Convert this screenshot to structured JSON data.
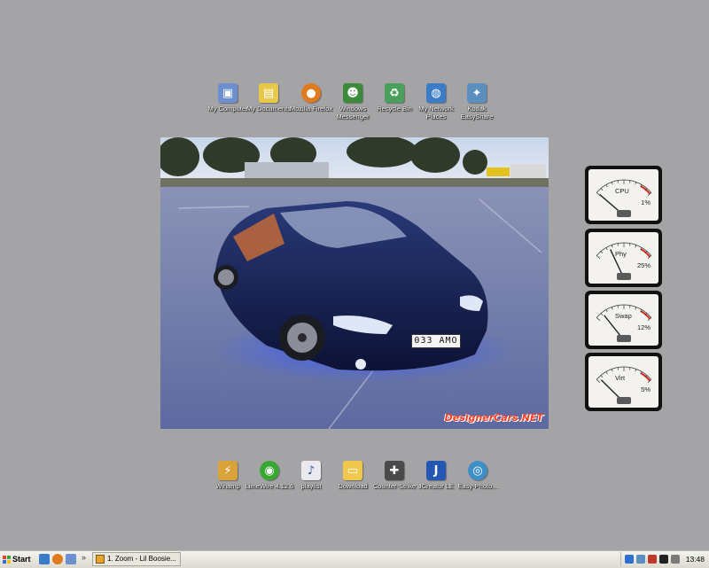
{
  "desktop_icons_top": [
    {
      "label": "My Computer",
      "icon": "my-computer-icon",
      "color": "#6d8fcf",
      "glyph": "🖥"
    },
    {
      "label": "My Documents",
      "icon": "my-documents-icon",
      "color": "#e8c84a",
      "glyph": "📁"
    },
    {
      "label": "Mozilla Firefox",
      "icon": "firefox-icon",
      "color": "#e07a1f",
      "glyph": "🦊"
    },
    {
      "label": "Windows Messenger",
      "icon": "messenger-icon",
      "color": "#3a8a3a",
      "glyph": "👥"
    },
    {
      "label": "Recycle Bin",
      "icon": "recycle-bin-icon",
      "color": "#4aa05a",
      "glyph": "♻"
    },
    {
      "label": "My Network Places",
      "icon": "network-places-icon",
      "color": "#3b7cc9",
      "glyph": "🌐"
    },
    {
      "label": "Kodak EasyShare",
      "icon": "kodak-easyshare-icon",
      "color": "#5b8fbf",
      "glyph": "✦"
    }
  ],
  "desktop_icons_bottom": [
    {
      "label": "Winamp",
      "icon": "winamp-icon",
      "color": "#d9a33a",
      "glyph": "⚡"
    },
    {
      "label": "LimeWire 4.12.6",
      "icon": "limewire-icon",
      "color": "#39a832",
      "glyph": "◉"
    },
    {
      "label": "playlist",
      "icon": "playlist-icon",
      "color": "#e9e9ef",
      "glyph": "♪"
    },
    {
      "label": "Download",
      "icon": "download-folder-icon",
      "color": "#efc84d",
      "glyph": "📂"
    },
    {
      "label": "Counter-Strike",
      "icon": "counter-strike-icon",
      "color": "#4a4a4a",
      "glyph": "✚"
    },
    {
      "label": "JCreator LE",
      "icon": "jcreator-icon",
      "color": "#2456b3",
      "glyph": "J"
    },
    {
      "label": "Easy-Photo...",
      "icon": "easy-photo-icon",
      "color": "#3e8fc5",
      "glyph": "◎"
    }
  ],
  "wallpaper": {
    "plate_text": "033 AMO",
    "watermark": "DesignerCars.NET"
  },
  "gauges": [
    {
      "name": "CPU",
      "percent": 1,
      "percent_label": "1%"
    },
    {
      "name": "Phy",
      "percent": 25,
      "percent_label": "25%"
    },
    {
      "name": "Swap",
      "percent": 12,
      "percent_label": "12%"
    },
    {
      "name": "Virt",
      "percent": 5,
      "percent_label": "5%"
    }
  ],
  "taskbar": {
    "start_label": "Start",
    "chevron": "»",
    "task_button_label": "1. Zoom - Lil Boosie...",
    "clock": "13:48"
  },
  "colors": {
    "desktop_bg": "#a4a4a6",
    "gauge_needle": "#222222",
    "gauge_redzone": "#d62a1e"
  }
}
